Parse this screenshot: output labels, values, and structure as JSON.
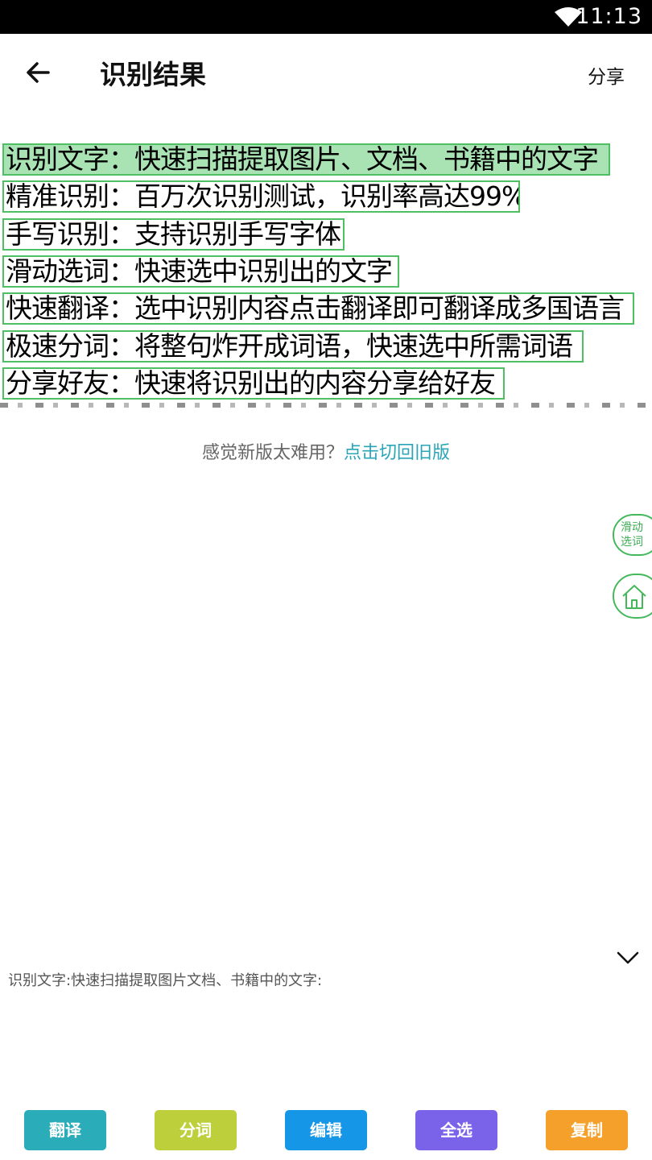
{
  "status_bar": {
    "time": "11:13"
  },
  "app_bar": {
    "title": "识别结果",
    "share_label": "分享"
  },
  "ocr_lines": [
    {
      "text": "识别文字：快速扫描提取图片、文档、书籍中的文字",
      "selected": true
    },
    {
      "text": "精准识别：百万次识别测试，识别率高达99%",
      "selected": false
    },
    {
      "text": "手写识别：支持识别手写字体",
      "selected": false
    },
    {
      "text": "滑动选词：快速选中识别出的文字",
      "selected": false
    },
    {
      "text": "快速翻译：选中识别内容点击翻译即可翻译成多国语言",
      "selected": false
    },
    {
      "text": "极速分词：将整句炸开成词语，快速选中所需词语",
      "selected": false
    },
    {
      "text": "分享好友：快速将识别出的内容分享给好友",
      "selected": false
    }
  ],
  "switch_hint": {
    "text": "感觉新版太难用？",
    "link": "点击切回旧版"
  },
  "float_buttons": {
    "slide_line1": "滑动",
    "slide_line2": "选词"
  },
  "result": {
    "text": "识别文字:快速扫描提取图片文档、书籍中的文字:"
  },
  "actions": [
    {
      "label": "翻译",
      "color": "#2aadb9"
    },
    {
      "label": "分词",
      "color": "#bdcf3a"
    },
    {
      "label": "编辑",
      "color": "#1596e6"
    },
    {
      "label": "全选",
      "color": "#7a63e8"
    },
    {
      "label": "复制",
      "color": "#f5a02a"
    }
  ],
  "colors": {
    "box_border": "#4fbf64",
    "box_selected": "#a9e3b4",
    "link": "#2aa5b8"
  },
  "icons": [
    "wifi-icon",
    "back-arrow-icon",
    "home-icon",
    "chevron-down-icon"
  ]
}
